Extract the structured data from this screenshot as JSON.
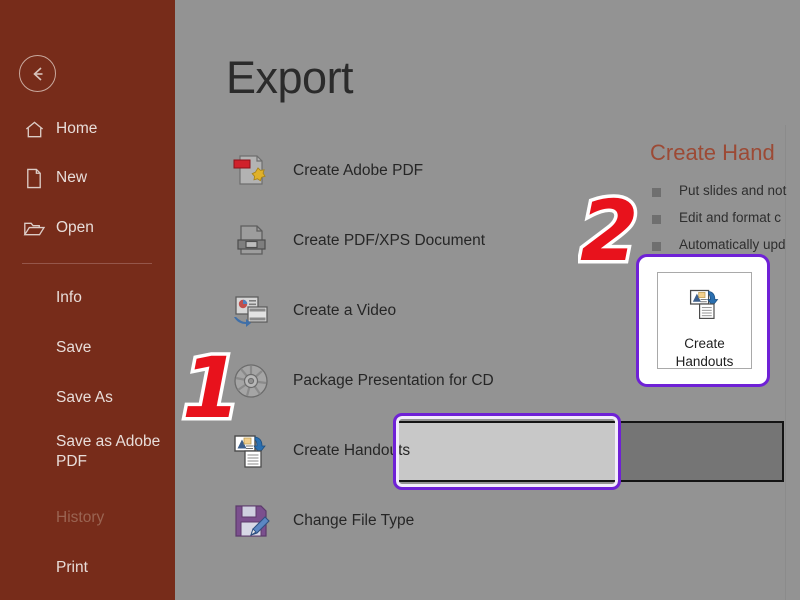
{
  "sidebar": {
    "back_icon": "back-arrow-icon",
    "items": [
      {
        "label": "Home",
        "icon": "home-icon",
        "style": "icon"
      },
      {
        "label": "New",
        "icon": "new-file-icon",
        "style": "icon"
      },
      {
        "label": "Open",
        "icon": "open-folder-icon",
        "style": "icon"
      },
      {
        "label": "Info",
        "icon": "",
        "style": "indent"
      },
      {
        "label": "Save",
        "icon": "",
        "style": "indent"
      },
      {
        "label": "Save As",
        "icon": "",
        "style": "indent"
      },
      {
        "label": "Save as Adobe PDF",
        "icon": "",
        "style": "indent-two-line"
      },
      {
        "label": "History",
        "icon": "",
        "style": "indent-dim"
      },
      {
        "label": "Print",
        "icon": "",
        "style": "indent"
      }
    ]
  },
  "main": {
    "title": "Export",
    "options": [
      {
        "label": "Create Adobe PDF",
        "icon": "adobe-pdf-icon"
      },
      {
        "label": "Create PDF/XPS Document",
        "icon": "pdf-xps-icon"
      },
      {
        "label": "Create a Video",
        "icon": "video-icon"
      },
      {
        "label": "Package Presentation for CD",
        "icon": "cd-disc-icon"
      },
      {
        "label": "Create Handouts",
        "icon": "handouts-icon"
      },
      {
        "label": "Change File Type",
        "icon": "change-file-type-icon"
      }
    ],
    "selected_option": "Create Handouts"
  },
  "info": {
    "title": "Create Hand",
    "bullets": [
      "Put slides and not",
      "Edit and format c",
      "Automatically upd"
    ],
    "button_line1": "Create",
    "button_line2": "Handouts"
  },
  "annotations": {
    "step1": "1",
    "step2": "2"
  },
  "colors": {
    "sidebar_bg": "#772c1a",
    "main_bg": "#939393",
    "accent_purple": "#6f21d6",
    "marker_red": "#e8121c",
    "info_title": "#9c4a35"
  }
}
